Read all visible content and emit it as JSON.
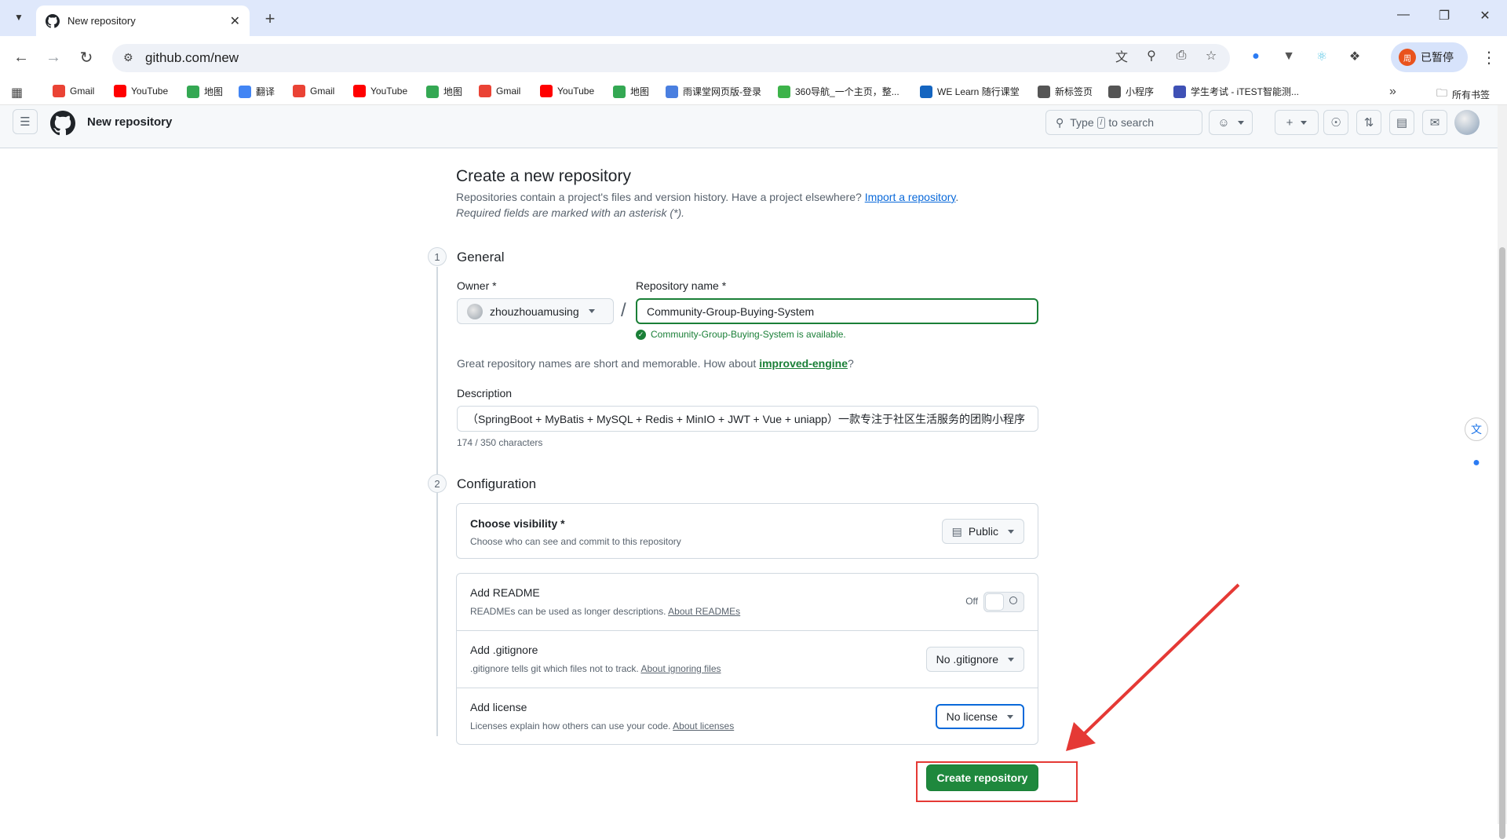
{
  "browser": {
    "tab_title": "New repository",
    "url": "github.com/new",
    "profile_label": "已暂停",
    "profile_avatar_letter": "周",
    "bookmarks": [
      {
        "label": "Gmail",
        "icon": "gmail-icon",
        "color": "#ea4335"
      },
      {
        "label": "YouTube",
        "icon": "youtube-icon",
        "color": "#ff0000"
      },
      {
        "label": "地图",
        "icon": "maps-icon",
        "color": "#34a853"
      },
      {
        "label": "翻译",
        "icon": "translate-icon",
        "color": "#4285f4"
      },
      {
        "label": "Gmail",
        "icon": "gmail-icon",
        "color": "#ea4335"
      },
      {
        "label": "YouTube",
        "icon": "youtube-icon",
        "color": "#ff0000"
      },
      {
        "label": "地图",
        "icon": "maps-icon",
        "color": "#34a853"
      },
      {
        "label": "Gmail",
        "icon": "gmail-icon",
        "color": "#ea4335"
      },
      {
        "label": "YouTube",
        "icon": "youtube-icon",
        "color": "#ff0000"
      },
      {
        "label": "地图",
        "icon": "maps-icon",
        "color": "#34a853"
      },
      {
        "label": "雨课堂网页版-登录",
        "icon": "yuketang-icon",
        "color": "#4a7fe0"
      },
      {
        "label": "360导航_一个主页，整...",
        "icon": "360-icon",
        "color": "#3db34a"
      },
      {
        "label": "WE Learn 随行课堂",
        "icon": "welearn-icon",
        "color": "#1565c0"
      },
      {
        "label": "新标签页",
        "icon": "chrome-icon",
        "color": "#555555"
      },
      {
        "label": "小程序",
        "icon": "folder-icon",
        "color": "#555555"
      },
      {
        "label": "学生考试 - iTEST智能测...",
        "icon": "itest-icon",
        "color": "#3f51b5"
      }
    ],
    "all_bookmarks_label": "所有书签"
  },
  "header": {
    "title": "New repository",
    "search_prefix": "Type",
    "search_key": "/",
    "search_suffix": "to search"
  },
  "page": {
    "heading": "Create a new repository",
    "intro": "Repositories contain a project's files and version history. Have a project elsewhere?",
    "import_link": "Import a repository",
    "intro_end": ".",
    "required_note": "Required fields are marked with an asterisk (*).",
    "general": {
      "step": "1",
      "title": "General",
      "owner_label": "Owner *",
      "owner_value": "zhouzhouamusing",
      "slash": "/",
      "repo_label": "Repository name *",
      "repo_value": "Community-Group-Buying-System",
      "available_msg": "Community-Group-Buying-System is available.",
      "suggestion_prefix": "Great repository names are short and memorable. How about",
      "suggestion_link": "improved-engine",
      "suggestion_end": "?",
      "description_label": "Description",
      "description_value": "（SpringBoot + MyBatis + MySQL + Redis + MinIO + JWT + Vue + uniapp）一款专注于社区生活服务的团购小程序",
      "char_count": "174 / 350 characters"
    },
    "configuration": {
      "step": "2",
      "title": "Configuration",
      "visibility_title": "Choose visibility *",
      "visibility_desc": "Choose who can see and commit to this repository",
      "visibility_value": "Public",
      "readme_title": "Add README",
      "readme_desc": "READMEs can be used as longer descriptions.",
      "readme_link": "About READMEs",
      "readme_state": "Off",
      "gitignore_title": "Add .gitignore",
      "gitignore_desc": ".gitignore tells git which files not to track.",
      "gitignore_link": "About ignoring files",
      "gitignore_value": "No .gitignore",
      "license_title": "Add license",
      "license_desc": "Licenses explain how others can use your code.",
      "license_link": "About licenses",
      "license_value": "No license"
    },
    "create_button": "Create repository"
  },
  "colors": {
    "primary_button": "#1f883d",
    "link": "#0969da",
    "success": "#1a7f37",
    "annotation": "#e53935"
  }
}
